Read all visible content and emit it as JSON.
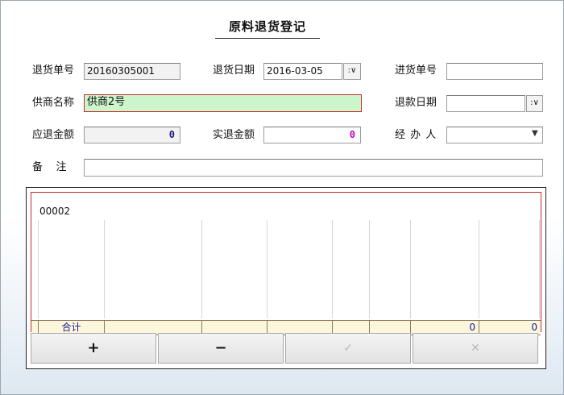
{
  "form": {
    "title": "原料退货登记",
    "return_no_label": "退货单号",
    "return_no": "20160305001",
    "return_date_label": "退货日期",
    "return_date": "2016-03-05",
    "purchase_no_label": "进货单号",
    "purchase_no": "",
    "supplier_label": "供商名称",
    "supplier": "供商2号",
    "refund_date_label": "退款日期",
    "refund_date": "",
    "payable_label": "应退金额",
    "payable": "0",
    "actual_label": "实退金额",
    "actual": "0",
    "handler_label": "经 办 人",
    "handler": "",
    "remark_label": "备    注",
    "remark": "",
    "dropdown_glyph": ":∨"
  },
  "grid": {
    "first_row_code": "00002",
    "total_label": "合计",
    "total_qty": "0",
    "total_amount": "0"
  },
  "buttons": {
    "add": "+",
    "remove": "−",
    "confirm": "✓",
    "cancel": "✕"
  },
  "colors": {
    "green_input": "#ccf5cc",
    "red_border": "#c32b2b",
    "payable_value": "#1a1a80",
    "actual_value": "#c000c0",
    "total_text": "#1a1a90"
  }
}
